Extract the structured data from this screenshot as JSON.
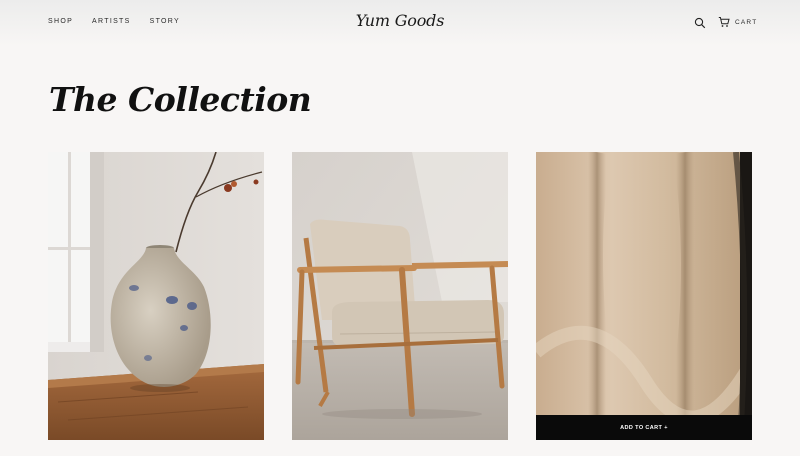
{
  "header": {
    "nav": [
      "SHOP",
      "ARTISTS",
      "STORY"
    ],
    "brand": "Yum Goods",
    "cart_label": "CART"
  },
  "main": {
    "title": "The Collection",
    "products": [
      {
        "image": "ceramic-vase-with-branch"
      },
      {
        "image": "wooden-lounge-chair"
      },
      {
        "image": "wool-throw-blanket",
        "add_to_cart_label": "ADD TO CART +"
      }
    ]
  },
  "colors": {
    "background": "#f8f6f5",
    "text": "#1a1a1a",
    "button": "#0a0a0a"
  }
}
